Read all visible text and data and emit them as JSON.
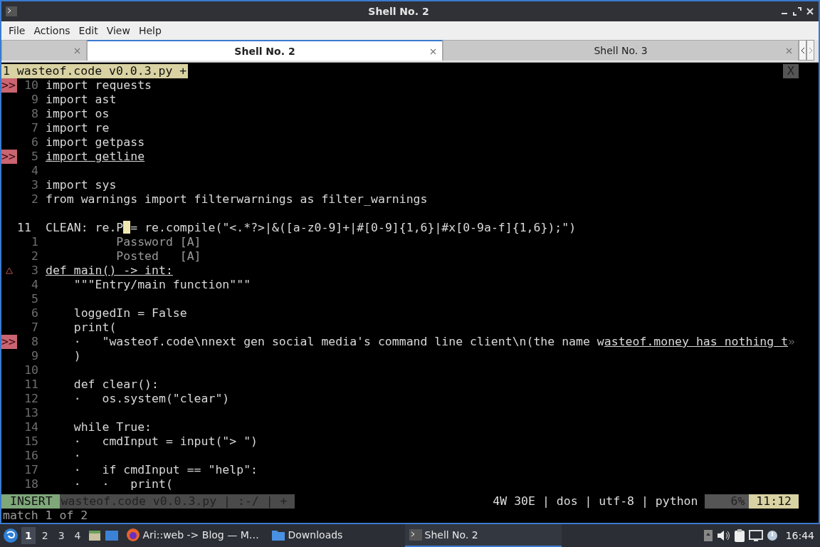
{
  "window": {
    "title": "Shell No. 2"
  },
  "menu": [
    "File",
    "Actions",
    "Edit",
    "View",
    "Help"
  ],
  "tabs": [
    {
      "selected": false
    },
    {
      "label": "Shell No. 2",
      "selected": true
    },
    {
      "label": "Shell No. 3",
      "selected": false
    }
  ],
  "editor": {
    "buffer_tab": "1 wasteof.code v0.0.3.py +",
    "close_label": "X",
    "lines": [
      {
        "sign": ">>",
        "number": "10",
        "text": "import requests"
      },
      {
        "number": "9",
        "text": "import ast"
      },
      {
        "number": "8",
        "text": "import os"
      },
      {
        "number": "7",
        "text": "import re"
      },
      {
        "number": "6",
        "text": "import getpass"
      },
      {
        "sign": ">>",
        "number": "5",
        "segments": [
          {
            "text": "import getline",
            "underline": true
          }
        ]
      },
      {
        "number": "4"
      },
      {
        "number": "3",
        "text": "import sys"
      },
      {
        "number": "2",
        "text": "from warnings import filterwarnings as filter_warnings"
      },
      {
        "kind": "blank"
      },
      {
        "number": "11",
        "current": true,
        "segments": [
          {
            "text": "CLEAN: re.P"
          },
          {
            "text": "= re.compile(\"<.*?>|&([a-z0-9]+|#[0-9]{1,6}|#x[0-9a-f]{1,6});\")",
            "cursor_before": true
          }
        ]
      },
      {
        "number": "1",
        "kind": "completion",
        "text": "          Password [A]"
      },
      {
        "number": "2",
        "kind": "completion",
        "text": "          Posted   [A]"
      },
      {
        "warning": true,
        "number": "3",
        "segments": [
          {
            "text": "def main() -> int:",
            "underline": true
          }
        ]
      },
      {
        "number": "4",
        "text": "    \"\"\"Entry/main function\"\"\""
      },
      {
        "number": "5"
      },
      {
        "number": "6",
        "text": "    loggedIn = False"
      },
      {
        "number": "7",
        "text": "    print("
      },
      {
        "sign": ">>",
        "number": "8",
        "segments": [
          {
            "text": "    ·   \"wasteof.code\\nnext gen social media's command line client\\n(the name w"
          },
          {
            "text": "asteof.money has nothing t",
            "underline": true
          },
          {
            "text": "»",
            "kind": "more"
          }
        ]
      },
      {
        "number": "9",
        "text": "    )"
      },
      {
        "number": "10"
      },
      {
        "number": "11",
        "text": "    def clear():"
      },
      {
        "number": "12",
        "text": "    ·   os.system(\"clear\")"
      },
      {
        "number": "13"
      },
      {
        "number": "14",
        "text": "    while True:"
      },
      {
        "number": "15",
        "text": "    ·   cmdInput = input(\"> \")"
      },
      {
        "number": "16",
        "text": "    ·"
      },
      {
        "number": "17",
        "text": "    ·   if cmdInput == \"help\":"
      },
      {
        "number": "18",
        "text": "    ·   ·   print("
      }
    ],
    "status": {
      "mode": "INSERT",
      "file": "wasteof.code v0.0.3.py | :-/ | +",
      "info": "4W 30E | dos | utf-8 | python",
      "percent": "6%",
      "position": "11:12"
    },
    "message": "match 1 of 2"
  },
  "taskbar": {
    "workspaces": [
      {
        "label": "1",
        "selected": true
      },
      {
        "label": "2",
        "selected": false
      },
      {
        "label": "3",
        "selected": false
      },
      {
        "label": "4",
        "selected": false
      }
    ],
    "tasks": [
      {
        "kind": "browser",
        "label": "Ari::web -> Blog — M…",
        "selected": false
      },
      {
        "kind": "folder",
        "label": "Downloads",
        "selected": false
      },
      {
        "kind": "terminal",
        "label": "Shell No. 2",
        "selected": true
      }
    ],
    "clock": "16:44"
  }
}
